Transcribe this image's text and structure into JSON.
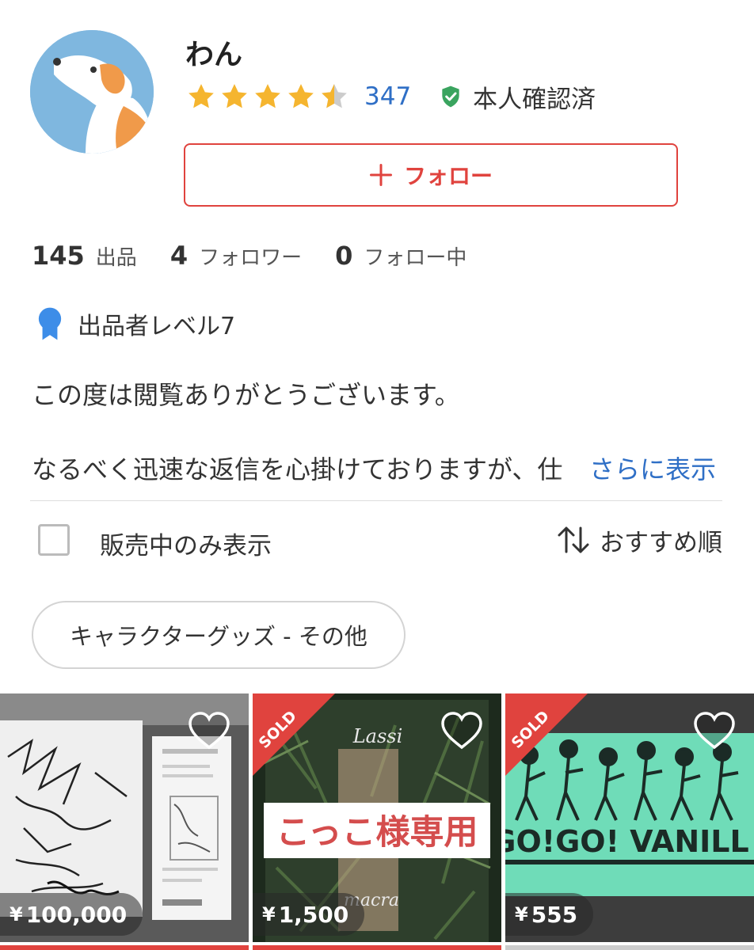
{
  "profile": {
    "username": "わん",
    "avatar_icon": "dog-avatar",
    "rating": 4.5,
    "rating_max": 5,
    "review_count": "347",
    "verified_label": "本人確認済",
    "verified_icon": "shield-check-icon",
    "follow_label": "フォロー",
    "follow_icon": "plus-icon"
  },
  "stats": [
    {
      "value": "145",
      "label": "出品"
    },
    {
      "value": "4",
      "label": "フォロワー"
    },
    {
      "value": "0",
      "label": "フォロー中"
    }
  ],
  "seller_level": {
    "icon": "badge-icon",
    "label": "出品者レベル7"
  },
  "bio": {
    "line1": "この度は閲覧ありがとうございます。",
    "line2": "なるべく迅速な返信を心掛けておりますが、仕",
    "show_more": "さらに表示"
  },
  "filter": {
    "label": "販売中のみ表示",
    "checked": false
  },
  "sort": {
    "icon": "sort-arrows-icon",
    "label": "おすすめ順"
  },
  "category_chip": "キャラクターグッズ - その他",
  "items": [
    {
      "currency": "¥",
      "price": "100,000",
      "sold": false
    },
    {
      "currency": "¥",
      "price": "1,500",
      "sold": true,
      "sold_label": "SOLD",
      "image_text_top": "Lassi",
      "image_overlay": "こっこ様専用",
      "image_text_bottom": "macra"
    },
    {
      "currency": "¥",
      "price": "555",
      "sold": true,
      "sold_label": "SOLD",
      "image_text": "GO!GO! VANILL"
    }
  ],
  "colors": {
    "accent_red": "#e0433e",
    "link_blue": "#2f6fc6",
    "star_gold": "#f5b52f",
    "verified_green": "#3aa45f",
    "badge_blue": "#3d8de8"
  }
}
